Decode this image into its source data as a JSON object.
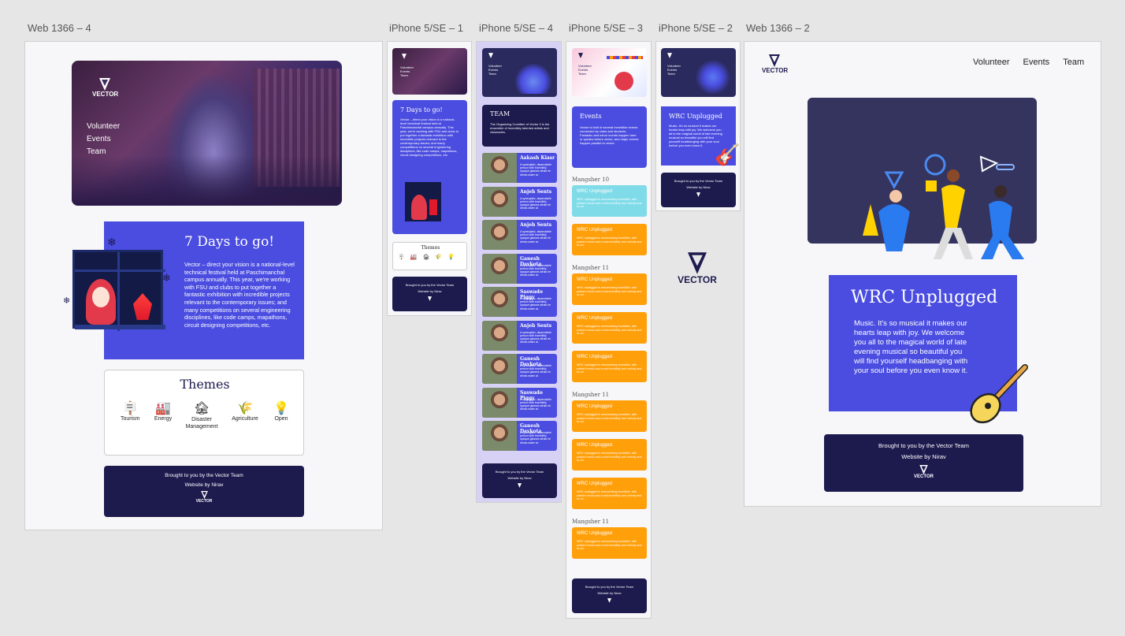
{
  "artboards": {
    "web4": "Web 1366 – 4",
    "ip1": "iPhone 5/SE – 1",
    "ip4": "iPhone 5/SE – 4",
    "ip3": "iPhone 5/SE – 3",
    "ip2": "iPhone 5/SE – 2",
    "web2": "Web 1366 – 2"
  },
  "brand": {
    "name": "VECTOR"
  },
  "nav": {
    "volunteer": "Volunteer",
    "events": "Events",
    "team": "Team"
  },
  "countdown": {
    "title": "7 Days to go!",
    "body": "Vector – direct your vision is a national-level technical festival held at Paschimanchal campus annually. This year, we're working with FSU and clubs to put together a fantastic exhibition with incredible projects relevant to the contemporary issues; and many competitions on several engineering disciplines, like code camps, mapathons, circuit designing competitions, etc."
  },
  "themes": {
    "title": "Themes",
    "items": [
      "Tourism",
      "Energy",
      "Disaster Management",
      "Agriculture",
      "Open"
    ]
  },
  "footer": {
    "line1": "Brought to you by the Vector Team",
    "line2": "Website by Nirav"
  },
  "team": {
    "title": "TEAM",
    "body": "The Organizing Comittee of Vector II is the ensemble of incredibly talented artists and visionaries.",
    "members": [
      "Aakash Kiasr",
      "Anjeh Sents",
      "Anjeh Sents",
      "Ganesh Devkota",
      "Saswado Piggy",
      "Anjeh Sents",
      "Ganesh Devkota",
      "Saswado Piggy",
      "Ganesh Devkota"
    ],
    "member_blurb": "A synergistic, dependable person with incredibly opaque glasses afraid he drinks water at."
  },
  "events": {
    "title": "Events",
    "body": "Vector is built of several incredible events conducted by clubs and students. Fantastic and minor events happen here or speaks before vector, and major events happen parallel to vector.",
    "dates": [
      "Mangsher 10",
      "Mangsher 11",
      "Mangsher 11",
      "Mangsher 11"
    ],
    "card_title": "WRC Unplugged",
    "card_body": "WRC unplugged is mesmerizing incredible, with praise's music and a real incredibly and melody and so on."
  },
  "unplugged": {
    "title": "WRC Unplugged",
    "body": "Music. It's so musical it makes our hearts leap with joy. We welcome you all to the magical world of late evening musical so beautiful you will find yourself headbanging with your soul before you even know it."
  }
}
